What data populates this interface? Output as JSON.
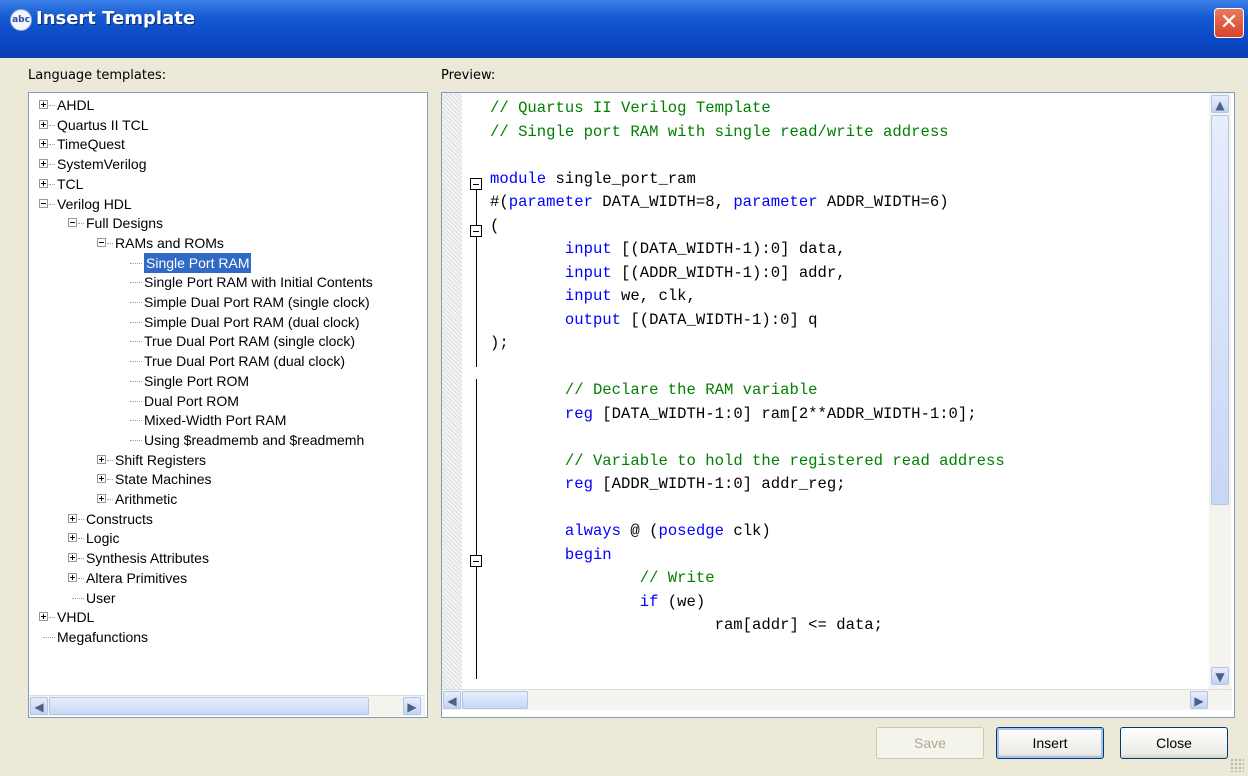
{
  "window": {
    "title": "Insert Template",
    "icon": "abc-app-icon",
    "close_glyph": "✕"
  },
  "labels": {
    "templates": "Language templates:",
    "preview": "Preview:"
  },
  "tree": [
    {
      "label": "AHDL",
      "level": 0,
      "toggle": "plus"
    },
    {
      "label": "Quartus II TCL",
      "level": 0,
      "toggle": "plus"
    },
    {
      "label": "TimeQuest",
      "level": 0,
      "toggle": "plus"
    },
    {
      "label": "SystemVerilog",
      "level": 0,
      "toggle": "plus"
    },
    {
      "label": "TCL",
      "level": 0,
      "toggle": "plus"
    },
    {
      "label": "Verilog HDL",
      "level": 0,
      "toggle": "minus"
    },
    {
      "label": "Full Designs",
      "level": 1,
      "toggle": "minus"
    },
    {
      "label": "RAMs and ROMs",
      "level": 2,
      "toggle": "minus"
    },
    {
      "label": "Single Port RAM",
      "level": 3,
      "toggle": "none",
      "selected": true
    },
    {
      "label": "Single Port RAM with Initial Contents",
      "level": 3,
      "toggle": "none"
    },
    {
      "label": "Simple Dual Port RAM (single clock)",
      "level": 3,
      "toggle": "none"
    },
    {
      "label": "Simple Dual Port RAM (dual clock)",
      "level": 3,
      "toggle": "none"
    },
    {
      "label": "True Dual Port RAM (single clock)",
      "level": 3,
      "toggle": "none"
    },
    {
      "label": "True Dual Port RAM (dual clock)",
      "level": 3,
      "toggle": "none"
    },
    {
      "label": "Single Port ROM",
      "level": 3,
      "toggle": "none"
    },
    {
      "label": "Dual Port ROM",
      "level": 3,
      "toggle": "none"
    },
    {
      "label": "Mixed-Width Port RAM",
      "level": 3,
      "toggle": "none"
    },
    {
      "label": "Using $readmemb and $readmemh",
      "level": 3,
      "toggle": "none"
    },
    {
      "label": "Shift Registers",
      "level": 2,
      "toggle": "plus"
    },
    {
      "label": "State Machines",
      "level": 2,
      "toggle": "plus"
    },
    {
      "label": "Arithmetic",
      "level": 2,
      "toggle": "plus"
    },
    {
      "label": "Constructs",
      "level": 1,
      "toggle": "plus"
    },
    {
      "label": "Logic",
      "level": 1,
      "toggle": "plus"
    },
    {
      "label": "Synthesis Attributes",
      "level": 1,
      "toggle": "plus"
    },
    {
      "label": "Altera Primitives",
      "level": 1,
      "toggle": "plus"
    },
    {
      "label": "User",
      "level": 1,
      "toggle": "none"
    },
    {
      "label": "VHDL",
      "level": 0,
      "toggle": "plus"
    },
    {
      "label": "Megafunctions",
      "level": 0,
      "toggle": "none"
    }
  ],
  "code_lines": [
    [
      {
        "t": "// Quartus II Verilog Template",
        "c": "cmt"
      }
    ],
    [
      {
        "t": "// Single port RAM with single read/write address",
        "c": "cmt"
      }
    ],
    [],
    [
      {
        "t": "module",
        "c": "kw"
      },
      {
        "t": " single_port_ram"
      }
    ],
    [
      {
        "t": "#("
      },
      {
        "t": "parameter",
        "c": "kw"
      },
      {
        "t": " DATA_WIDTH=8, "
      },
      {
        "t": "parameter",
        "c": "kw"
      },
      {
        "t": " ADDR_WIDTH=6)"
      }
    ],
    [
      {
        "t": "("
      }
    ],
    [
      {
        "t": "        "
      },
      {
        "t": "input",
        "c": "kw"
      },
      {
        "t": " [(DATA_WIDTH-1):0] data,"
      }
    ],
    [
      {
        "t": "        "
      },
      {
        "t": "input",
        "c": "kw"
      },
      {
        "t": " [(ADDR_WIDTH-1):0] addr,"
      }
    ],
    [
      {
        "t": "        "
      },
      {
        "t": "input",
        "c": "kw"
      },
      {
        "t": " we, clk,"
      }
    ],
    [
      {
        "t": "        "
      },
      {
        "t": "output",
        "c": "kw"
      },
      {
        "t": " [(DATA_WIDTH-1):0] q"
      }
    ],
    [
      {
        "t": ");"
      }
    ],
    [],
    [
      {
        "t": "        "
      },
      {
        "t": "// Declare the RAM variable",
        "c": "cmt"
      }
    ],
    [
      {
        "t": "        "
      },
      {
        "t": "reg",
        "c": "kw"
      },
      {
        "t": " [DATA_WIDTH-1:0] ram[2**ADDR_WIDTH-1:0];"
      }
    ],
    [],
    [
      {
        "t": "        "
      },
      {
        "t": "// Variable to hold the registered read address",
        "c": "cmt"
      }
    ],
    [
      {
        "t": "        "
      },
      {
        "t": "reg",
        "c": "kw"
      },
      {
        "t": " [ADDR_WIDTH-1:0] addr_reg;"
      }
    ],
    [],
    [
      {
        "t": "        "
      },
      {
        "t": "always",
        "c": "kw"
      },
      {
        "t": " @ ("
      },
      {
        "t": "posedge",
        "c": "kw"
      },
      {
        "t": " clk)"
      }
    ],
    [
      {
        "t": "        "
      },
      {
        "t": "begin",
        "c": "kw"
      }
    ],
    [
      {
        "t": "                "
      },
      {
        "t": "// Write",
        "c": "cmt"
      }
    ],
    [
      {
        "t": "                "
      },
      {
        "t": "if",
        "c": "kw"
      },
      {
        "t": " (we)"
      }
    ],
    [
      {
        "t": "                        ram[addr] <= data;"
      }
    ]
  ],
  "buttons": {
    "save": "Save",
    "insert": "Insert",
    "close": "Close"
  },
  "scroll_glyphs": {
    "left": "<",
    "right": ">",
    "up": "^",
    "down": "v",
    "thumb": "|||"
  }
}
